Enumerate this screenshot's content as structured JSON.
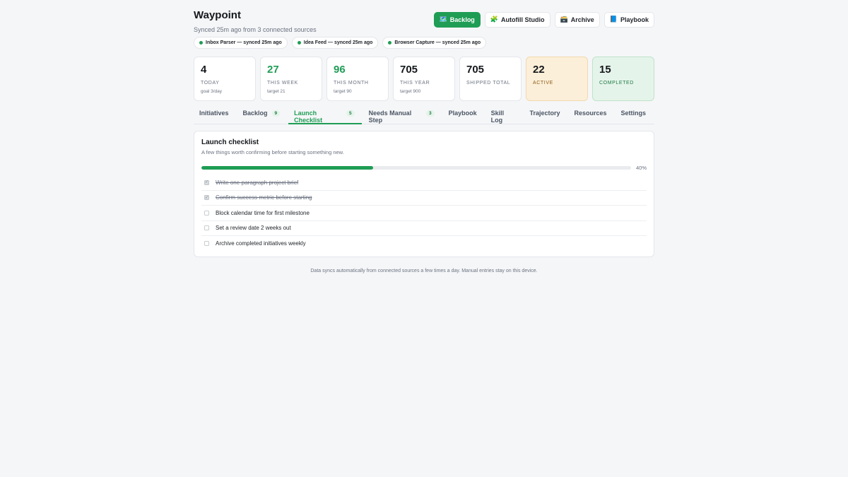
{
  "app": {
    "title": "Waypoint",
    "sync_status": "Synced 25m ago from 3 connected sources"
  },
  "actions": [
    {
      "icon": "🗺️",
      "icon_name": "map-icon",
      "label": "Backlog",
      "primary": true
    },
    {
      "icon": "🧩",
      "icon_name": "puzzle-icon",
      "label": "Autofill Studio",
      "primary": false
    },
    {
      "icon": "🗃️",
      "icon_name": "card-file-box-icon",
      "label": "Archive",
      "primary": false
    },
    {
      "icon": "📘",
      "icon_name": "blue-book-icon",
      "label": "Playbook",
      "primary": false
    }
  ],
  "sources": [
    {
      "label": "Inbox Parser — synced 25m ago"
    },
    {
      "label": "Idea Feed — synced 25m ago"
    },
    {
      "label": "Browser Capture — synced 25m ago"
    }
  ],
  "stats": [
    {
      "value": "4",
      "label": "TODAY",
      "sub": "goal 3/day",
      "style": "plain"
    },
    {
      "value": "27",
      "label": "THIS WEEK",
      "sub": "target 21",
      "style": "green"
    },
    {
      "value": "96",
      "label": "THIS MONTH",
      "sub": "target 90",
      "style": "green"
    },
    {
      "value": "705",
      "label": "THIS YEAR",
      "sub": "target 900",
      "style": "plain"
    },
    {
      "value": "705",
      "label": "SHIPPED TOTAL",
      "sub": "",
      "style": "plain"
    },
    {
      "value": "22",
      "label": "ACTIVE",
      "sub": "",
      "style": "active"
    },
    {
      "value": "15",
      "label": "COMPLETED",
      "sub": "",
      "style": "completed"
    }
  ],
  "tabs": [
    {
      "label": "Initiatives",
      "count": ""
    },
    {
      "label": "Backlog",
      "count": "9"
    },
    {
      "label": "Launch Checklist",
      "count": "5",
      "active": true
    },
    {
      "label": "Needs Manual Step",
      "count": "3"
    },
    {
      "label": "Playbook",
      "count": ""
    },
    {
      "label": "Skill Log",
      "count": ""
    },
    {
      "label": "Trajectory",
      "count": ""
    },
    {
      "label": "Resources",
      "count": ""
    },
    {
      "label": "Settings",
      "count": ""
    }
  ],
  "checklist": {
    "title": "Launch checklist",
    "subtitle": "A few things worth confirming before starting something new.",
    "progress": 0.4,
    "progress_label": "40%",
    "items": [
      {
        "text": "Write one-paragraph project brief",
        "done": true
      },
      {
        "text": "Confirm success metric before starting",
        "done": true
      },
      {
        "text": "Block calendar time for first milestone",
        "done": false
      },
      {
        "text": "Set a review date 2 weeks out",
        "done": false
      },
      {
        "text": "Archive completed initiatives weekly",
        "done": false
      }
    ]
  },
  "footer": "Data syncs automatically from connected sources a few times a day. Manual entries stay on this device.",
  "colors": {
    "accent": "#1f9d55",
    "active_bg": "#fcefd9",
    "completed_bg": "#e5f4ea"
  }
}
